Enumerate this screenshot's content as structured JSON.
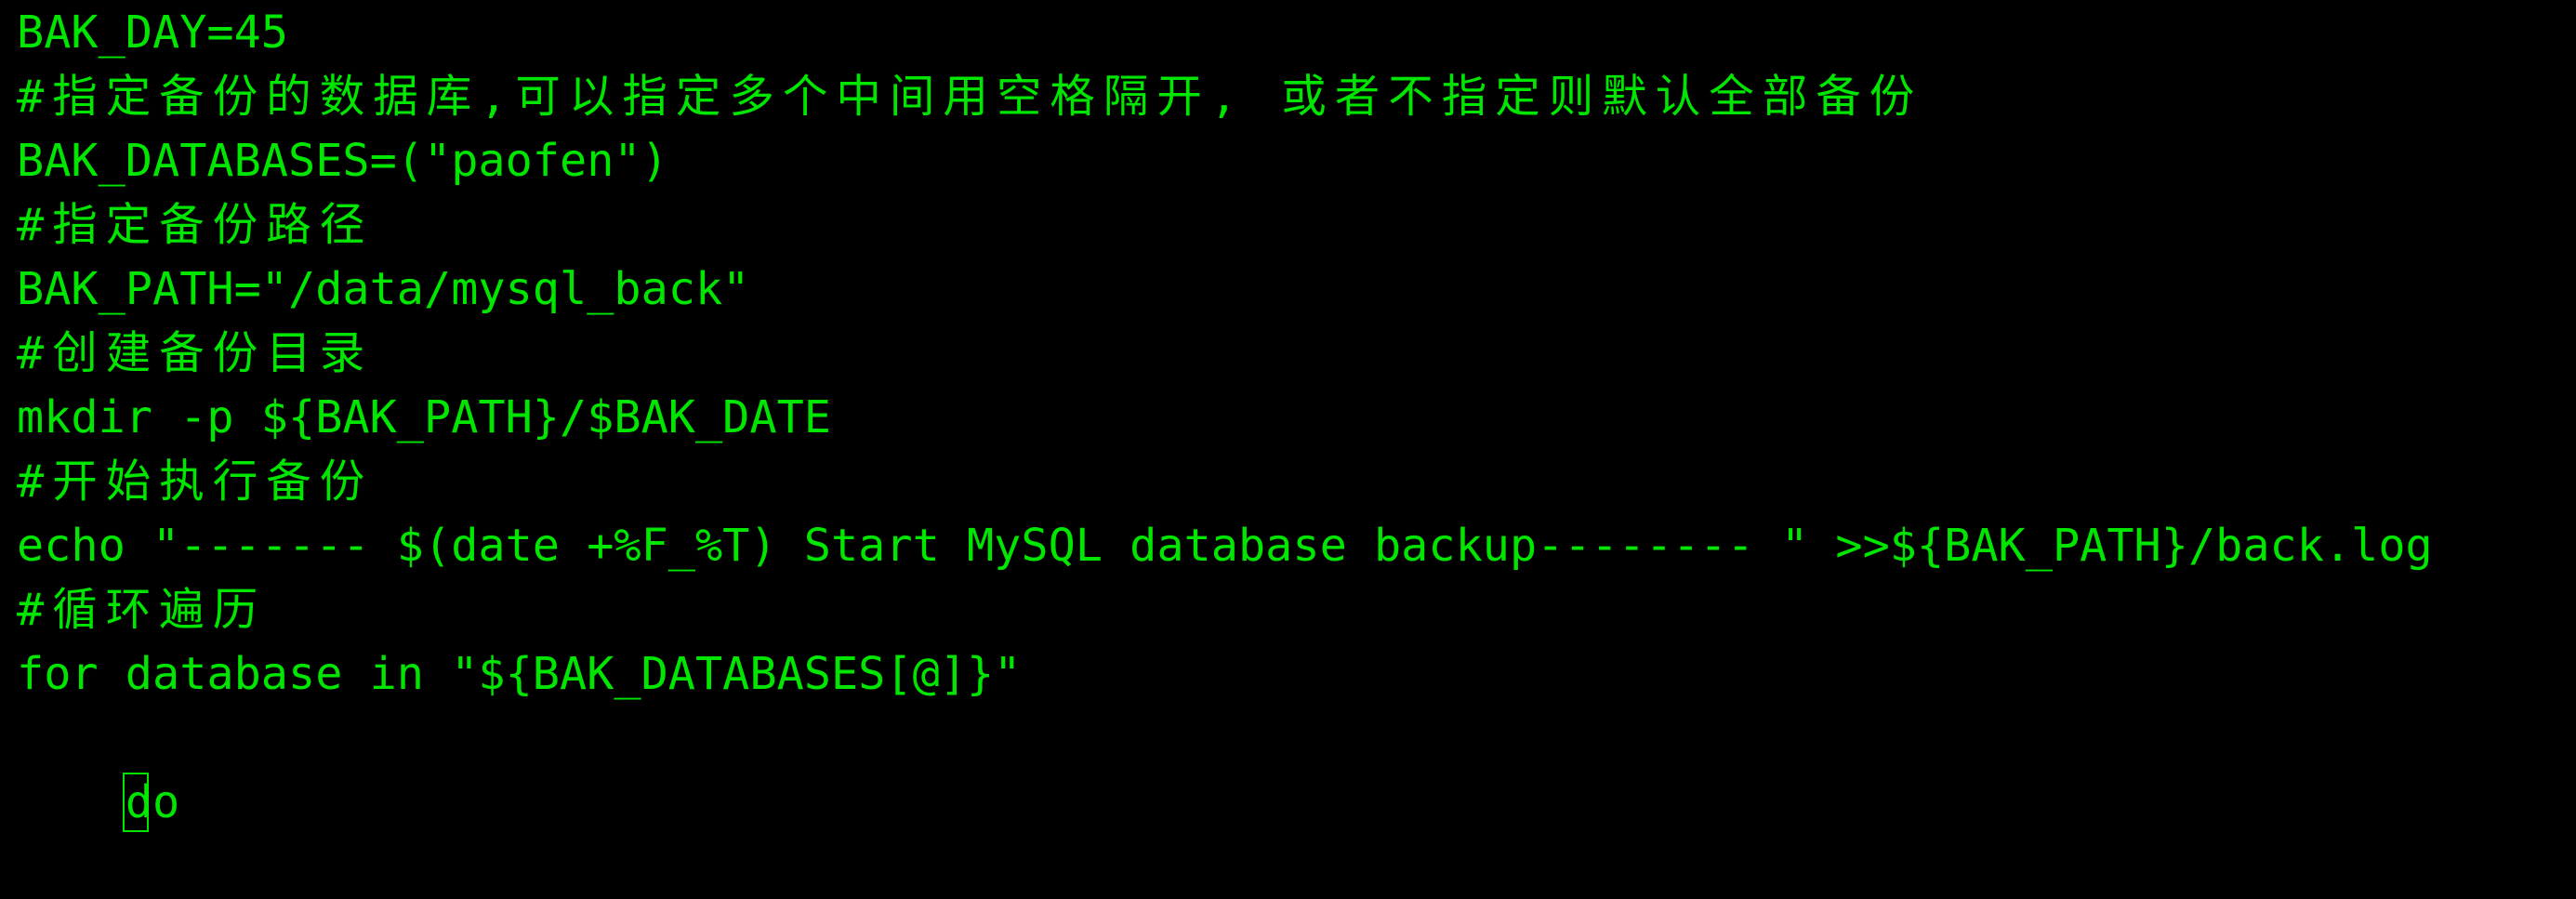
{
  "terminal": {
    "text_color": "#00e600",
    "background_color": "#000000",
    "lines": [
      "BAK_DAY=45",
      "#指定备份的数据库,可以指定多个中间用空格隔开, 或者不指定则默认全部备份",
      "BAK_DATABASES=(\"paofen\")",
      "#指定备份路径",
      "BAK_PATH=\"/data/mysql_back\"",
      "#创建备份目录",
      "mkdir -p ${BAK_PATH}/$BAK_DATE",
      "#开始执行备份",
      "echo \"------- $(date +%F_%T) Start MySQL database backup-------- \" >>${BAK_PATH}/back.log",
      "#循环遍历",
      "for database in \"${BAK_DATABASES[@]}\""
    ],
    "cursor_line": {
      "cursor_char": "d",
      "rest": "o"
    }
  }
}
